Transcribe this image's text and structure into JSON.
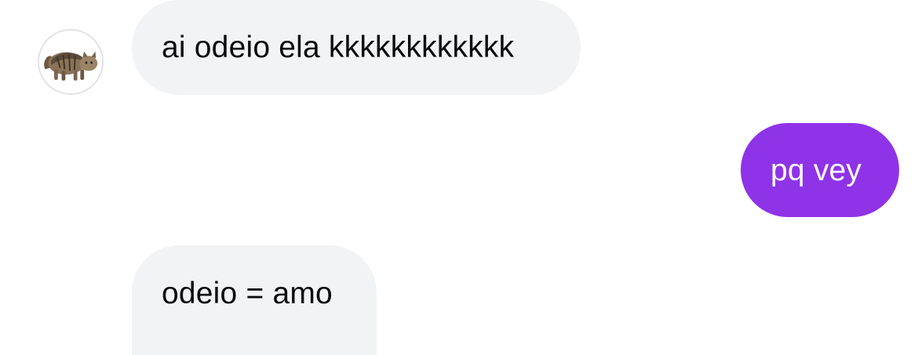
{
  "conversation": {
    "contact_avatar": {
      "icon": "cat-photo-avatar",
      "border_color": "#e2e2e6"
    },
    "messages": [
      {
        "direction": "incoming",
        "text": "ai odeio ela kkkkkkkkkkkk"
      },
      {
        "direction": "outgoing",
        "text": "pq vey"
      },
      {
        "direction": "incoming",
        "text": "odeio = amo"
      }
    ]
  },
  "colors": {
    "incoming_bubble": "#f2f3f5",
    "incoming_text": "#0b0b0f",
    "outgoing_bubble": "#8f33e8",
    "outgoing_text": "#ffffff",
    "background": "#ffffff"
  }
}
